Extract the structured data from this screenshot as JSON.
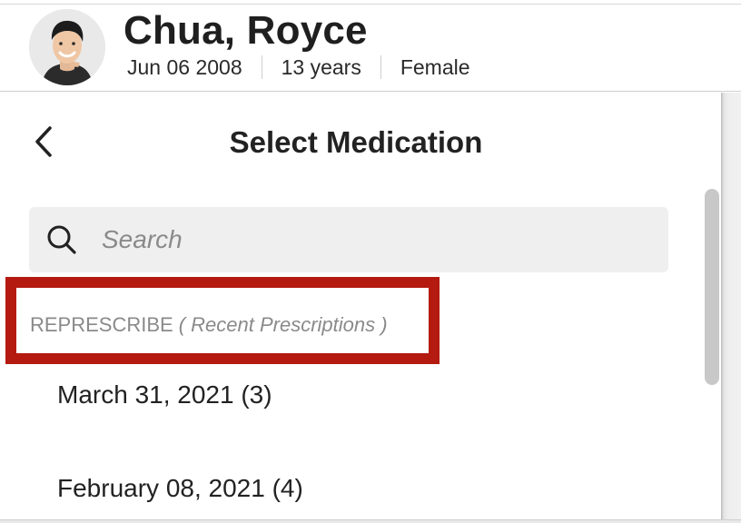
{
  "patient": {
    "name": "Chua, Royce",
    "dob": "Jun 06 2008",
    "age": "13 years",
    "sex": "Female"
  },
  "panel": {
    "title": "Select Medication",
    "back_icon": "chevron-left-icon"
  },
  "search": {
    "placeholder": "Search",
    "value": "",
    "icon": "search-icon"
  },
  "represcribe_section": {
    "title": "REPRESCRIBE",
    "subtitle": "( Recent Prescriptions )",
    "highlight_color": "#b41a10",
    "items": [
      {
        "label": "March 31, 2021 (3)"
      },
      {
        "label": "February 08, 2021 (4)"
      }
    ]
  }
}
